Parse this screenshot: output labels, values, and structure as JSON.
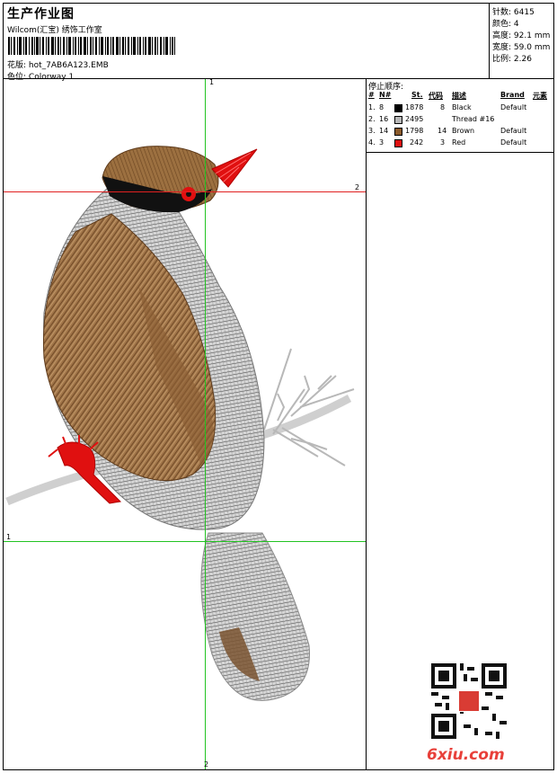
{
  "header": {
    "title": "生产作业图",
    "studio": "Wilcom(汇宝) 绣饰工作室",
    "design_label": "花版:",
    "design_name": "hot_7AB6A123.EMB",
    "colorway_label": "色位:",
    "colorway_name": "Colorway 1"
  },
  "info": {
    "stitches_label": "针数:",
    "stitches": "6415",
    "colors_label": "颜色:",
    "colors": "4",
    "height_label": "高度:",
    "height": "92.1 mm",
    "width_label": "宽度:",
    "width": "59.0 mm",
    "ratio_label": "比例:",
    "ratio": "2.26"
  },
  "guides": {
    "v_top": "1",
    "v_bottom": "2",
    "h1_right": "2",
    "h2_left": "1"
  },
  "sequence": {
    "title": "停止顺序:",
    "headers": {
      "idx": "#",
      "no": "N#",
      "st": "St.",
      "code": "代码",
      "desc": "描述",
      "brand": "Brand",
      "elem": "元素"
    },
    "rows": [
      {
        "idx": "1.",
        "no": "8",
        "color": "#000000",
        "st": "1878",
        "code": "8",
        "desc": "Black",
        "brand": "Default"
      },
      {
        "idx": "2.",
        "no": "16",
        "color": "#b8b8b8",
        "st": "2495",
        "code": "",
        "desc": "Thread #16",
        "brand": ""
      },
      {
        "idx": "3.",
        "no": "14",
        "color": "#8b5a2b",
        "st": "1798",
        "code": "14",
        "desc": "Brown",
        "brand": "Default"
      },
      {
        "idx": "4.",
        "no": "3",
        "color": "#e01010",
        "st": "242",
        "code": "3",
        "desc": "Red",
        "brand": "Default"
      }
    ]
  },
  "watermark": {
    "logo": "6xiu.com"
  }
}
